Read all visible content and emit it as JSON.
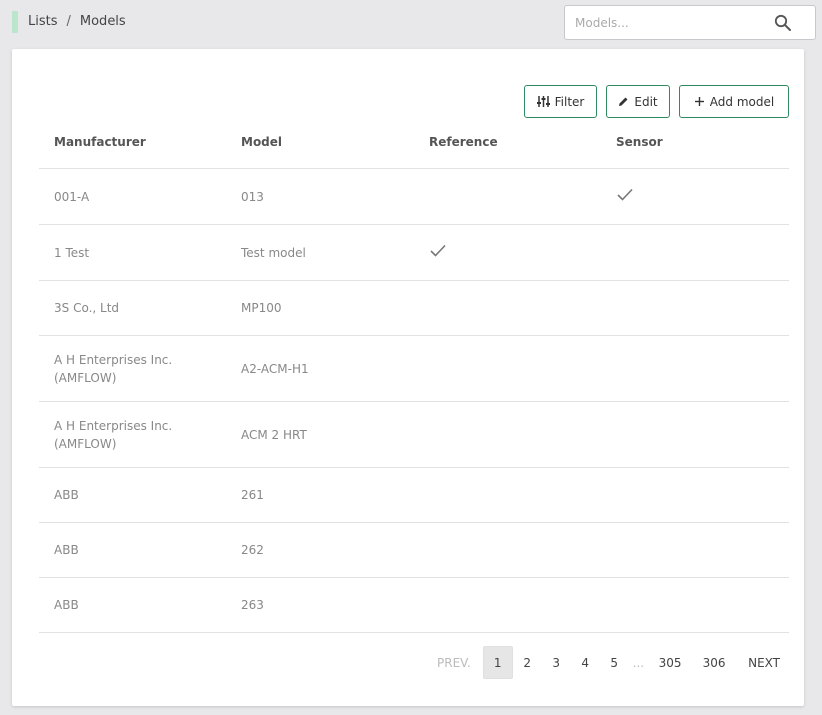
{
  "breadcrumb": {
    "parent": "Lists",
    "separator": "/",
    "current": "Models"
  },
  "search": {
    "placeholder": "Models...",
    "value": ""
  },
  "toolbar": {
    "filter_label": "Filter",
    "edit_label": "Edit",
    "add_label": "Add model"
  },
  "table": {
    "columns": [
      "Manufacturer",
      "Model",
      "Reference",
      "Sensor"
    ],
    "rows": [
      {
        "manufacturer": "001-A",
        "model": "013",
        "reference": false,
        "sensor": true
      },
      {
        "manufacturer": "1 Test",
        "model": "Test model",
        "reference": true,
        "sensor": false
      },
      {
        "manufacturer": "3S Co., Ltd",
        "model": "MP100",
        "reference": false,
        "sensor": false
      },
      {
        "manufacturer": "A H Enterprises Inc. (AMFLOW)",
        "model": "A2-ACM-H1",
        "reference": false,
        "sensor": false
      },
      {
        "manufacturer": "A H Enterprises Inc. (AMFLOW)",
        "model": "ACM 2 HRT",
        "reference": false,
        "sensor": false
      },
      {
        "manufacturer": "ABB",
        "model": "261",
        "reference": false,
        "sensor": false
      },
      {
        "manufacturer": "ABB",
        "model": "262",
        "reference": false,
        "sensor": false
      },
      {
        "manufacturer": "ABB",
        "model": "263",
        "reference": false,
        "sensor": false
      }
    ]
  },
  "pagination": {
    "prev_label": "PREV.",
    "next_label": "NEXT",
    "pages": [
      "1",
      "2",
      "3",
      "4",
      "5"
    ],
    "ellipsis": "...",
    "last_pages": [
      "305",
      "306"
    ],
    "current": "1"
  },
  "colors": {
    "accent": "#2f8a5f",
    "accent_light": "#b9e6cc"
  }
}
